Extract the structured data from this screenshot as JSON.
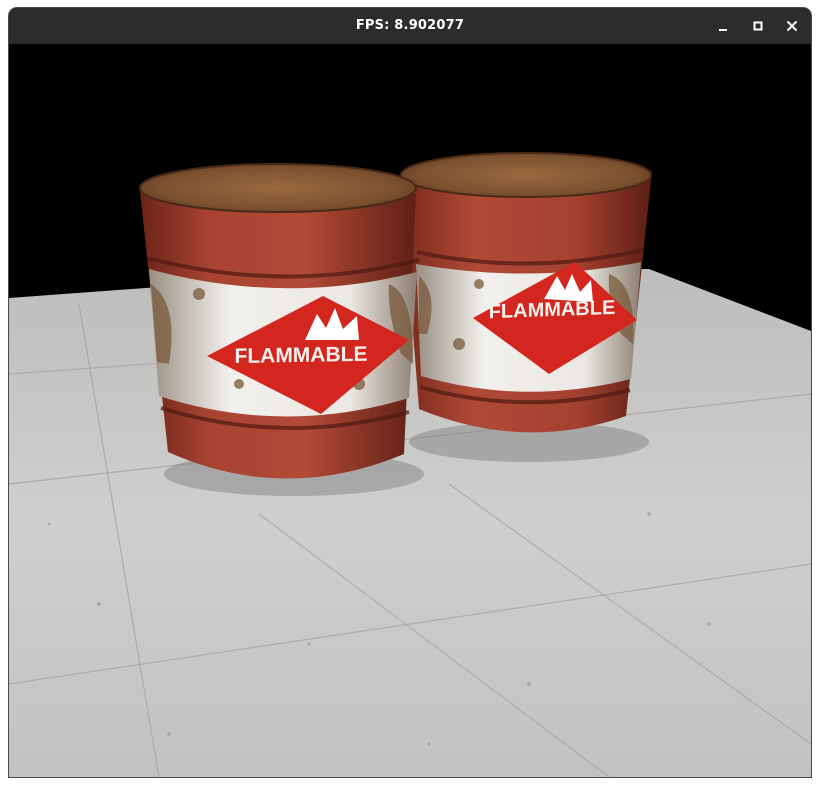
{
  "window": {
    "title": "FPS: 8.902077",
    "controls": {
      "minimize_icon": "minimize-icon",
      "maximize_icon": "maximize-icon",
      "close_icon": "close-icon"
    }
  },
  "scene": {
    "background_color": "#000000",
    "floor_color": "#c9c9c7",
    "barrel_color": "#a8402f",
    "label_color": "#d3261f",
    "barrels": [
      {
        "label": "FLAMMABLE"
      },
      {
        "label": "FLAMMABLE"
      }
    ]
  }
}
